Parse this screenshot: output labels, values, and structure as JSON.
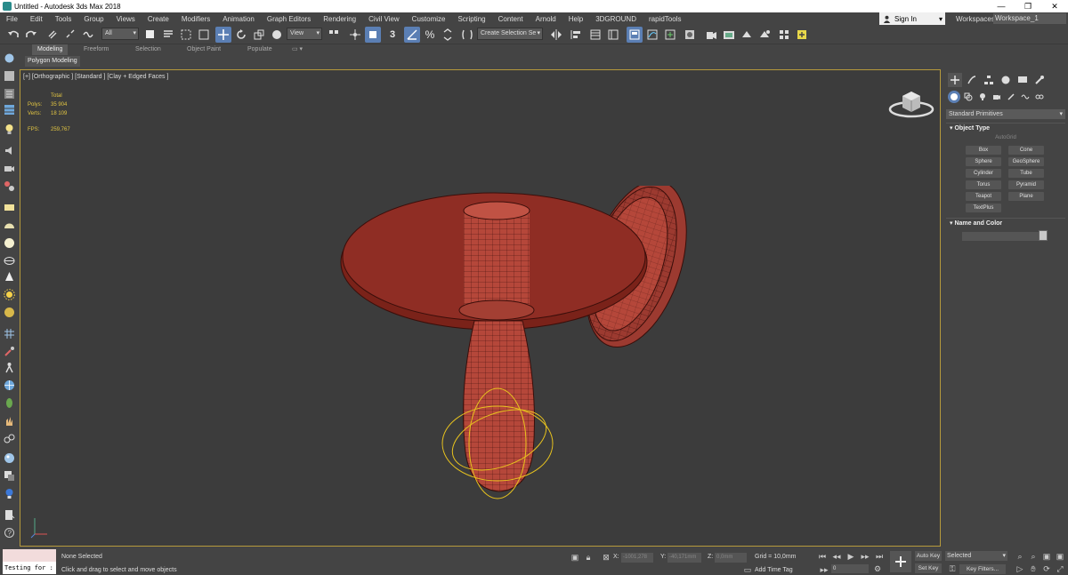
{
  "window": {
    "title": "Untitled - Autodesk 3ds Max 2018",
    "controls": [
      "—",
      "❐",
      "✕"
    ]
  },
  "menu": [
    "File",
    "Edit",
    "Tools",
    "Group",
    "Views",
    "Create",
    "Modifiers",
    "Animation",
    "Graph Editors",
    "Rendering",
    "Civil View",
    "Customize",
    "Scripting",
    "Content",
    "Arnold",
    "Help",
    "3DGROUND",
    "rapidTools"
  ],
  "account": {
    "sign_in": "Sign In",
    "workspaces_label": "Workspaces:",
    "workspace_value": "Workspace_1"
  },
  "toolbar": {
    "selection_filter": "All",
    "ref_coord": "View",
    "named_selection": "Create Selection Se"
  },
  "ribbon": {
    "tabs": [
      "Modeling",
      "Freeform",
      "Selection",
      "Object Paint",
      "Populate"
    ],
    "active_tab": "Modeling",
    "panel_label": "Polygon Modeling"
  },
  "viewport": {
    "label": "[+] [Orthographic ] [Standard ] [Clay + Edged Faces ]",
    "stats_header": "Total",
    "stats": [
      {
        "k": "Polys:",
        "v": "35 904"
      },
      {
        "k": "Verts:",
        "v": "18 109"
      }
    ],
    "fps_label": "FPS:",
    "fps_value": "259,767"
  },
  "command_panel": {
    "category": "Standard Primitives",
    "object_type_title": "Object Type",
    "autogrid": "AutoGrid",
    "primitives": [
      "Box",
      "Cone",
      "Sphere",
      "GeoSphere",
      "Cylinder",
      "Tube",
      "Torus",
      "Pyramid",
      "Teapot",
      "Plane",
      "TextPlus"
    ],
    "name_color_title": "Name and Color"
  },
  "status": {
    "listener_text": "Testing for :",
    "selection": "None Selected",
    "prompt": "Click and drag to select and move objects",
    "x_label": "X:",
    "x_value": "-1001,278",
    "y_label": "Y:",
    "y_value": "-40,171mm",
    "z_label": "Z:",
    "z_value": "0,0mm",
    "grid": "Grid = 10,0mm",
    "add_time_tag": "Add Time Tag",
    "frame": "0",
    "auto_key": "Auto Key",
    "set_key": "Set Key",
    "selected": "Selected",
    "key_filters": "Key Filters..."
  },
  "colors": {
    "accent": "#5b7fb4",
    "model": "#b5473a",
    "wire": "#3a0e0a",
    "selection": "#e8c31e",
    "viewport_border": "#b69a3c"
  }
}
